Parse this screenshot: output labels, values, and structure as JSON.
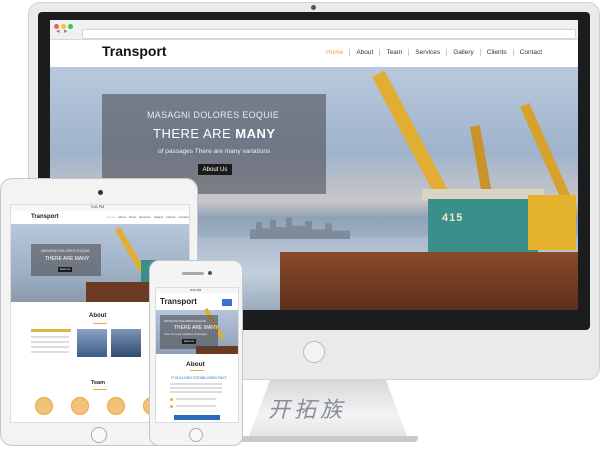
{
  "desktop": {
    "logo": "Transport",
    "nav": [
      "Home",
      "About",
      "Team",
      "Services",
      "Gallery",
      "Clients",
      "Contact"
    ],
    "hero": {
      "line1": "MASAGNI DOLORES EOQUIE",
      "line2_light": "THERE ARE ",
      "line2_bold": "MANY",
      "line3": "of passages There are many variations",
      "button": "About Us",
      "vessel_number": "415"
    }
  },
  "tablet": {
    "logo": "Transport",
    "nav": [
      "Home",
      "About",
      "Team",
      "Services",
      "Gallery",
      "Clients",
      "Contact"
    ],
    "status": "9:41 PM",
    "hero_line1": "MASAGNI DOLORES EOQUIE",
    "hero_line2": "THERE ARE MANY",
    "button": "About Us",
    "about_title": "About",
    "team_title": "Team"
  },
  "phone": {
    "logo": "Transport",
    "status": "9:41 PM",
    "hero_line1": "MASAGNI DOLORES EOQUIE",
    "hero_line2": "THERE ARE MANY",
    "hero_line3": "There are many variations of passages",
    "button": "About Us",
    "about_title": "About",
    "about_subtitle": "IT IS A LONG ESTABLISHED FACT"
  },
  "watermark": "开拓族"
}
